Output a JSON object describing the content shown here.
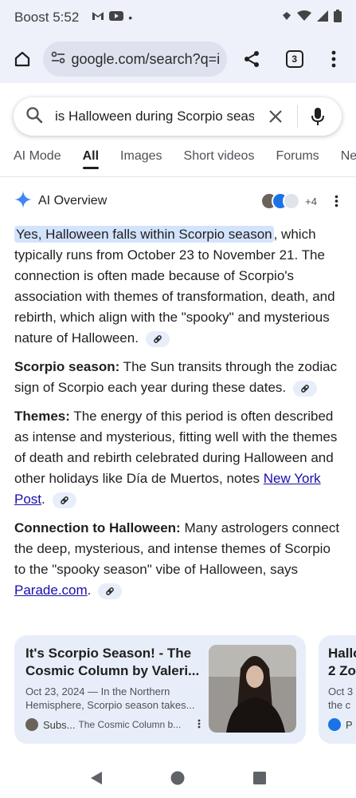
{
  "status": {
    "carrier_time": "Boost 5:52",
    "dot": "•"
  },
  "browser": {
    "url": "google.com/search?q=is",
    "tab_count": "3"
  },
  "search": {
    "query": "is Halloween during Scorpio season"
  },
  "tabs": [
    "AI Mode",
    "All",
    "Images",
    "Short videos",
    "Forums",
    "News"
  ],
  "aio": {
    "title": "AI Overview",
    "sources_more": "+4",
    "para1_highlight": "Yes, Halloween falls within Scorpio season",
    "para1_rest": ", which typically runs from October 23 to November 21. The connection is often made because of Scorpio's association with themes of transformation, death, and rebirth, which align with the \"spooky\" and mysterious nature of Halloween.",
    "p2_label": "Scorpio season:",
    "p2_text": " The Sun transits through the zodiac sign of Scorpio each year during these dates.",
    "p3_label": "Themes:",
    "p3_text": " The energy of this period is often described as intense and mysterious, fitting well with the themes of death and rebirth celebrated during Halloween and other holidays like Día de Muertos, notes ",
    "p3_link": "New York Post",
    "p4_label": "Connection to Halloween:",
    "p4_text": " Many astrologers connect the deep, mysterious, and intense themes of Scorpio to the \"spooky season\" vibe of Halloween, says ",
    "p4_link": "Parade.com",
    "period": "."
  },
  "cards": [
    {
      "title": "It's Scorpio Season! - The Cosmic Column by Valeri...",
      "snippet": "Oct 23, 2024 — In the Northern Hemisphere, Scorpio season takes...",
      "source_short": "Subs...",
      "source_name": "The Cosmic Column b..."
    },
    {
      "title": "Hallo 2 Zo",
      "snippet": "Oct 3 the c",
      "source_short": "P"
    }
  ],
  "colors": {
    "chrome_bg": "#eef1f9",
    "highlight": "#d3e3fd",
    "link": "#1a0dab",
    "card_bg": "#e8eef9"
  }
}
